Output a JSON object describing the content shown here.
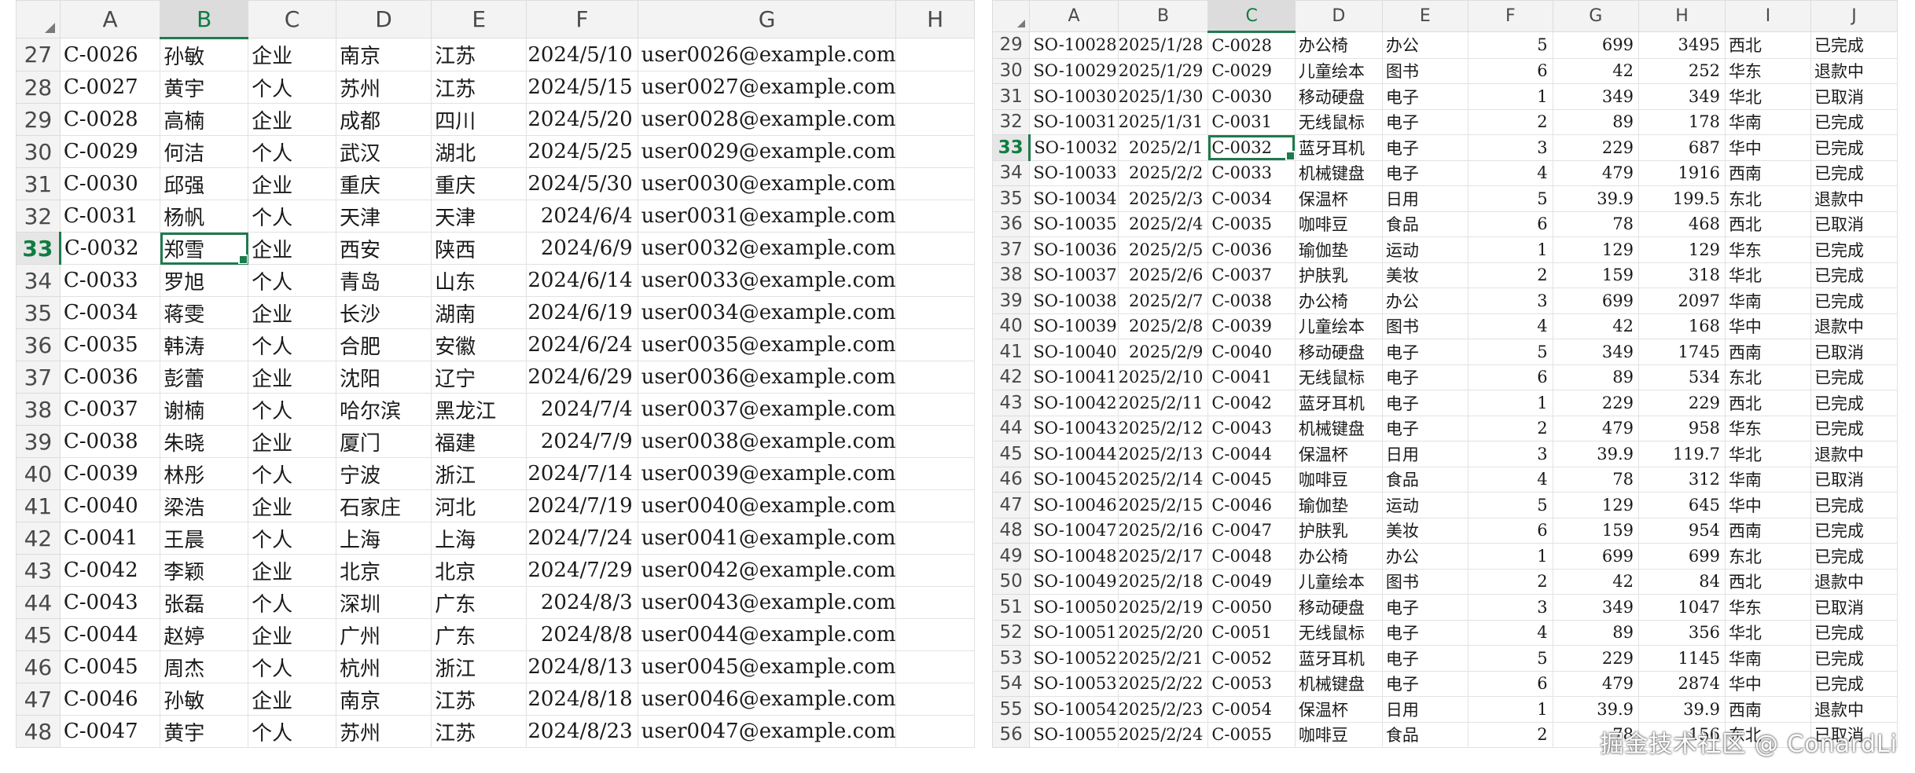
{
  "left_sheet": {
    "columns": [
      "A",
      "B",
      "C",
      "D",
      "E",
      "F",
      "G",
      "H"
    ],
    "active_column": "B",
    "active_row": "33",
    "rows": [
      {
        "n": "27",
        "id": "C-0026",
        "name": "孙敏",
        "type": "企业",
        "city": "南京",
        "prov": "江苏",
        "date": "2024/5/10",
        "email": "user0026@example.com"
      },
      {
        "n": "28",
        "id": "C-0027",
        "name": "黄宇",
        "type": "个人",
        "city": "苏州",
        "prov": "江苏",
        "date": "2024/5/15",
        "email": "user0027@example.com"
      },
      {
        "n": "29",
        "id": "C-0028",
        "name": "高楠",
        "type": "企业",
        "city": "成都",
        "prov": "四川",
        "date": "2024/5/20",
        "email": "user0028@example.com"
      },
      {
        "n": "30",
        "id": "C-0029",
        "name": "何洁",
        "type": "个人",
        "city": "武汉",
        "prov": "湖北",
        "date": "2024/5/25",
        "email": "user0029@example.com"
      },
      {
        "n": "31",
        "id": "C-0030",
        "name": "邱强",
        "type": "企业",
        "city": "重庆",
        "prov": "重庆",
        "date": "2024/5/30",
        "email": "user0030@example.com"
      },
      {
        "n": "32",
        "id": "C-0031",
        "name": "杨帆",
        "type": "个人",
        "city": "天津",
        "prov": "天津",
        "date": "2024/6/4",
        "email": "user0031@example.com"
      },
      {
        "n": "33",
        "id": "C-0032",
        "name": "郑雪",
        "type": "企业",
        "city": "西安",
        "prov": "陕西",
        "date": "2024/6/9",
        "email": "user0032@example.com"
      },
      {
        "n": "34",
        "id": "C-0033",
        "name": "罗旭",
        "type": "个人",
        "city": "青岛",
        "prov": "山东",
        "date": "2024/6/14",
        "email": "user0033@example.com"
      },
      {
        "n": "35",
        "id": "C-0034",
        "name": "蒋雯",
        "type": "企业",
        "city": "长沙",
        "prov": "湖南",
        "date": "2024/6/19",
        "email": "user0034@example.com"
      },
      {
        "n": "36",
        "id": "C-0035",
        "name": "韩涛",
        "type": "个人",
        "city": "合肥",
        "prov": "安徽",
        "date": "2024/6/24",
        "email": "user0035@example.com"
      },
      {
        "n": "37",
        "id": "C-0036",
        "name": "彭蕾",
        "type": "企业",
        "city": "沈阳",
        "prov": "辽宁",
        "date": "2024/6/29",
        "email": "user0036@example.com"
      },
      {
        "n": "38",
        "id": "C-0037",
        "name": "谢楠",
        "type": "个人",
        "city": "哈尔滨",
        "prov": "黑龙江",
        "date": "2024/7/4",
        "email": "user0037@example.com"
      },
      {
        "n": "39",
        "id": "C-0038",
        "name": "朱晓",
        "type": "企业",
        "city": "厦门",
        "prov": "福建",
        "date": "2024/7/9",
        "email": "user0038@example.com"
      },
      {
        "n": "40",
        "id": "C-0039",
        "name": "林彤",
        "type": "个人",
        "city": "宁波",
        "prov": "浙江",
        "date": "2024/7/14",
        "email": "user0039@example.com"
      },
      {
        "n": "41",
        "id": "C-0040",
        "name": "梁浩",
        "type": "企业",
        "city": "石家庄",
        "prov": "河北",
        "date": "2024/7/19",
        "email": "user0040@example.com"
      },
      {
        "n": "42",
        "id": "C-0041",
        "name": "王晨",
        "type": "个人",
        "city": "上海",
        "prov": "上海",
        "date": "2024/7/24",
        "email": "user0041@example.com"
      },
      {
        "n": "43",
        "id": "C-0042",
        "name": "李颖",
        "type": "企业",
        "city": "北京",
        "prov": "北京",
        "date": "2024/7/29",
        "email": "user0042@example.com"
      },
      {
        "n": "44",
        "id": "C-0043",
        "name": "张磊",
        "type": "个人",
        "city": "深圳",
        "prov": "广东",
        "date": "2024/8/3",
        "email": "user0043@example.com"
      },
      {
        "n": "45",
        "id": "C-0044",
        "name": "赵婷",
        "type": "企业",
        "city": "广州",
        "prov": "广东",
        "date": "2024/8/8",
        "email": "user0044@example.com"
      },
      {
        "n": "46",
        "id": "C-0045",
        "name": "周杰",
        "type": "个人",
        "city": "杭州",
        "prov": "浙江",
        "date": "2024/8/13",
        "email": "user0045@example.com"
      },
      {
        "n": "47",
        "id": "C-0046",
        "name": "孙敏",
        "type": "企业",
        "city": "南京",
        "prov": "江苏",
        "date": "2024/8/18",
        "email": "user0046@example.com"
      },
      {
        "n": "48",
        "id": "C-0047",
        "name": "黄宇",
        "type": "个人",
        "city": "苏州",
        "prov": "江苏",
        "date": "2024/8/23",
        "email": "user0047@example.com"
      }
    ]
  },
  "right_sheet": {
    "columns": [
      "A",
      "B",
      "C",
      "D",
      "E",
      "F",
      "G",
      "H",
      "I",
      "J"
    ],
    "active_column": "C",
    "active_row": "33",
    "rows": [
      {
        "n": "29",
        "order": "SO-10028",
        "date": "2025/1/28",
        "cust": "C-0028",
        "product": "办公椅",
        "cat": "办公",
        "qty": "5",
        "price": "699",
        "amount": "3495",
        "region": "西北",
        "status": "已完成"
      },
      {
        "n": "30",
        "order": "SO-10029",
        "date": "2025/1/29",
        "cust": "C-0029",
        "product": "儿童绘本",
        "cat": "图书",
        "qty": "6",
        "price": "42",
        "amount": "252",
        "region": "华东",
        "status": "退款中"
      },
      {
        "n": "31",
        "order": "SO-10030",
        "date": "2025/1/30",
        "cust": "C-0030",
        "product": "移动硬盘",
        "cat": "电子",
        "qty": "1",
        "price": "349",
        "amount": "349",
        "region": "华北",
        "status": "已取消"
      },
      {
        "n": "32",
        "order": "SO-10031",
        "date": "2025/1/31",
        "cust": "C-0031",
        "product": "无线鼠标",
        "cat": "电子",
        "qty": "2",
        "price": "89",
        "amount": "178",
        "region": "华南",
        "status": "已完成"
      },
      {
        "n": "33",
        "order": "SO-10032",
        "date": "2025/2/1",
        "cust": "C-0032",
        "product": "蓝牙耳机",
        "cat": "电子",
        "qty": "3",
        "price": "229",
        "amount": "687",
        "region": "华中",
        "status": "已完成"
      },
      {
        "n": "34",
        "order": "SO-10033",
        "date": "2025/2/2",
        "cust": "C-0033",
        "product": "机械键盘",
        "cat": "电子",
        "qty": "4",
        "price": "479",
        "amount": "1916",
        "region": "西南",
        "status": "已完成"
      },
      {
        "n": "35",
        "order": "SO-10034",
        "date": "2025/2/3",
        "cust": "C-0034",
        "product": "保温杯",
        "cat": "日用",
        "qty": "5",
        "price": "39.9",
        "amount": "199.5",
        "region": "东北",
        "status": "退款中"
      },
      {
        "n": "36",
        "order": "SO-10035",
        "date": "2025/2/4",
        "cust": "C-0035",
        "product": "咖啡豆",
        "cat": "食品",
        "qty": "6",
        "price": "78",
        "amount": "468",
        "region": "西北",
        "status": "已取消"
      },
      {
        "n": "37",
        "order": "SO-10036",
        "date": "2025/2/5",
        "cust": "C-0036",
        "product": "瑜伽垫",
        "cat": "运动",
        "qty": "1",
        "price": "129",
        "amount": "129",
        "region": "华东",
        "status": "已完成"
      },
      {
        "n": "38",
        "order": "SO-10037",
        "date": "2025/2/6",
        "cust": "C-0037",
        "product": "护肤乳",
        "cat": "美妆",
        "qty": "2",
        "price": "159",
        "amount": "318",
        "region": "华北",
        "status": "已完成"
      },
      {
        "n": "39",
        "order": "SO-10038",
        "date": "2025/2/7",
        "cust": "C-0038",
        "product": "办公椅",
        "cat": "办公",
        "qty": "3",
        "price": "699",
        "amount": "2097",
        "region": "华南",
        "status": "已完成"
      },
      {
        "n": "40",
        "order": "SO-10039",
        "date": "2025/2/8",
        "cust": "C-0039",
        "product": "儿童绘本",
        "cat": "图书",
        "qty": "4",
        "price": "42",
        "amount": "168",
        "region": "华中",
        "status": "退款中"
      },
      {
        "n": "41",
        "order": "SO-10040",
        "date": "2025/2/9",
        "cust": "C-0040",
        "product": "移动硬盘",
        "cat": "电子",
        "qty": "5",
        "price": "349",
        "amount": "1745",
        "region": "西南",
        "status": "已取消"
      },
      {
        "n": "42",
        "order": "SO-10041",
        "date": "2025/2/10",
        "cust": "C-0041",
        "product": "无线鼠标",
        "cat": "电子",
        "qty": "6",
        "price": "89",
        "amount": "534",
        "region": "东北",
        "status": "已完成"
      },
      {
        "n": "43",
        "order": "SO-10042",
        "date": "2025/2/11",
        "cust": "C-0042",
        "product": "蓝牙耳机",
        "cat": "电子",
        "qty": "1",
        "price": "229",
        "amount": "229",
        "region": "西北",
        "status": "已完成"
      },
      {
        "n": "44",
        "order": "SO-10043",
        "date": "2025/2/12",
        "cust": "C-0043",
        "product": "机械键盘",
        "cat": "电子",
        "qty": "2",
        "price": "479",
        "amount": "958",
        "region": "华东",
        "status": "已完成"
      },
      {
        "n": "45",
        "order": "SO-10044",
        "date": "2025/2/13",
        "cust": "C-0044",
        "product": "保温杯",
        "cat": "日用",
        "qty": "3",
        "price": "39.9",
        "amount": "119.7",
        "region": "华北",
        "status": "退款中"
      },
      {
        "n": "46",
        "order": "SO-10045",
        "date": "2025/2/14",
        "cust": "C-0045",
        "product": "咖啡豆",
        "cat": "食品",
        "qty": "4",
        "price": "78",
        "amount": "312",
        "region": "华南",
        "status": "已取消"
      },
      {
        "n": "47",
        "order": "SO-10046",
        "date": "2025/2/15",
        "cust": "C-0046",
        "product": "瑜伽垫",
        "cat": "运动",
        "qty": "5",
        "price": "129",
        "amount": "645",
        "region": "华中",
        "status": "已完成"
      },
      {
        "n": "48",
        "order": "SO-10047",
        "date": "2025/2/16",
        "cust": "C-0047",
        "product": "护肤乳",
        "cat": "美妆",
        "qty": "6",
        "price": "159",
        "amount": "954",
        "region": "西南",
        "status": "已完成"
      },
      {
        "n": "49",
        "order": "SO-10048",
        "date": "2025/2/17",
        "cust": "C-0048",
        "product": "办公椅",
        "cat": "办公",
        "qty": "1",
        "price": "699",
        "amount": "699",
        "region": "东北",
        "status": "已完成"
      },
      {
        "n": "50",
        "order": "SO-10049",
        "date": "2025/2/18",
        "cust": "C-0049",
        "product": "儿童绘本",
        "cat": "图书",
        "qty": "2",
        "price": "42",
        "amount": "84",
        "region": "西北",
        "status": "退款中"
      },
      {
        "n": "51",
        "order": "SO-10050",
        "date": "2025/2/19",
        "cust": "C-0050",
        "product": "移动硬盘",
        "cat": "电子",
        "qty": "3",
        "price": "349",
        "amount": "1047",
        "region": "华东",
        "status": "已取消"
      },
      {
        "n": "52",
        "order": "SO-10051",
        "date": "2025/2/20",
        "cust": "C-0051",
        "product": "无线鼠标",
        "cat": "电子",
        "qty": "4",
        "price": "89",
        "amount": "356",
        "region": "华北",
        "status": "已完成"
      },
      {
        "n": "53",
        "order": "SO-10052",
        "date": "2025/2/21",
        "cust": "C-0052",
        "product": "蓝牙耳机",
        "cat": "电子",
        "qty": "5",
        "price": "229",
        "amount": "1145",
        "region": "华南",
        "status": "已完成"
      },
      {
        "n": "54",
        "order": "SO-10053",
        "date": "2025/2/22",
        "cust": "C-0053",
        "product": "机械键盘",
        "cat": "电子",
        "qty": "6",
        "price": "479",
        "amount": "2874",
        "region": "华中",
        "status": "已完成"
      },
      {
        "n": "55",
        "order": "SO-10054",
        "date": "2025/2/23",
        "cust": "C-0054",
        "product": "保温杯",
        "cat": "日用",
        "qty": "1",
        "price": "39.9",
        "amount": "39.9",
        "region": "西南",
        "status": "退款中"
      },
      {
        "n": "56",
        "order": "SO-10055",
        "date": "2025/2/24",
        "cust": "C-0055",
        "product": "咖啡豆",
        "cat": "食品",
        "qty": "2",
        "price": "78",
        "amount": "156",
        "region": "东北",
        "status": "已取消"
      }
    ]
  },
  "watermark": "掘金技术社区 @ ConardLi"
}
